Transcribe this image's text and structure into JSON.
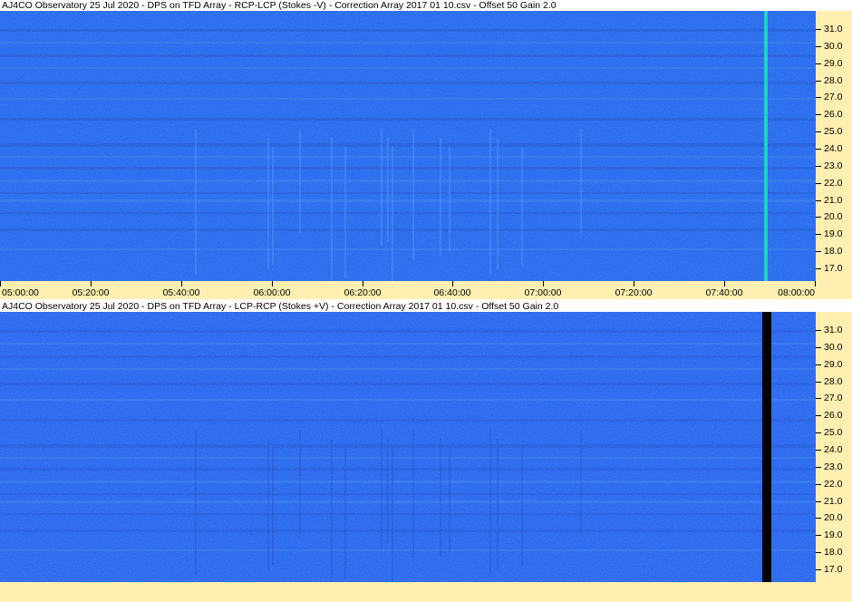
{
  "panels": [
    {
      "id": "top",
      "title": "AJ4CO Observatory 25 Jul 2020  -  DPS on TFD Array  -  RCP-LCP (Stokes -V)  -  Correction Array 2017 01 10.csv  -  Offset 50  Gain 2.0",
      "colors": {
        "base": "#1f63ec",
        "band_dark": "#1848c8",
        "band_light": "#3a82f2",
        "burst": "#5aa6ff",
        "stripe": "#1fd0c8"
      },
      "freq_labels": [
        "31.0",
        "30.0",
        "29.0",
        "28.0",
        "27.0",
        "26.0",
        "25.0",
        "24.0",
        "23.0",
        "22.0",
        "21.0",
        "20.0",
        "19.0",
        "18.0",
        "17.0"
      ],
      "time_labels": [
        "05:00:00",
        "05:20:00",
        "05:40:00",
        "06:00:00",
        "06:20:00",
        "06:40:00",
        "07:00:00",
        "07:20:00",
        "07:40:00",
        "08:00:00"
      ]
    },
    {
      "id": "bottom",
      "title": "AJ4CO Observatory 25 Jul 2020  -  DPS on TFD Array  -  LCP-RCP (Stokes +V)  -  Correction Array 2017 01 10.csv  -  Offset 50  Gain 2.0",
      "colors": {
        "base": "#2160ec",
        "band_dark": "#1a4ad0",
        "band_light": "#3b80f2",
        "burst": "#1838b0",
        "stripe": "#000000"
      },
      "freq_labels": [
        "31.0",
        "30.0",
        "29.0",
        "28.0",
        "27.0",
        "26.0",
        "25.0",
        "24.0",
        "23.0",
        "22.0",
        "21.0",
        "20.0",
        "19.0",
        "18.0",
        "17.0"
      ],
      "time_labels": []
    }
  ]
}
